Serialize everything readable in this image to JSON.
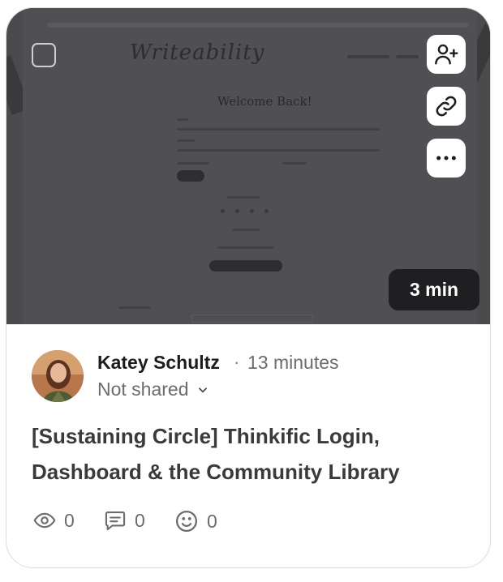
{
  "thumbnail": {
    "duration": "3 min",
    "preview": {
      "logo": "Writeability",
      "heading": "Welcome Back!"
    },
    "icons": {
      "select": "checkbox-icon",
      "add_user": "add-user-icon",
      "link": "link-icon",
      "more": "more-icon"
    }
  },
  "author": {
    "name": "Katey Schultz",
    "separator": "·",
    "time": "13 minutes",
    "sharing": "Not shared"
  },
  "video": {
    "title": "[Sustaining Circle] Thinkific Login, Dashboard & the Community Library"
  },
  "stats": {
    "views": "0",
    "comments": "0",
    "reactions": "0"
  },
  "colors": {
    "overlay": "#4b4b4e",
    "badge": "#1f1f22",
    "text_primary": "#1c1c1e",
    "text_secondary": "#6b6b70"
  }
}
